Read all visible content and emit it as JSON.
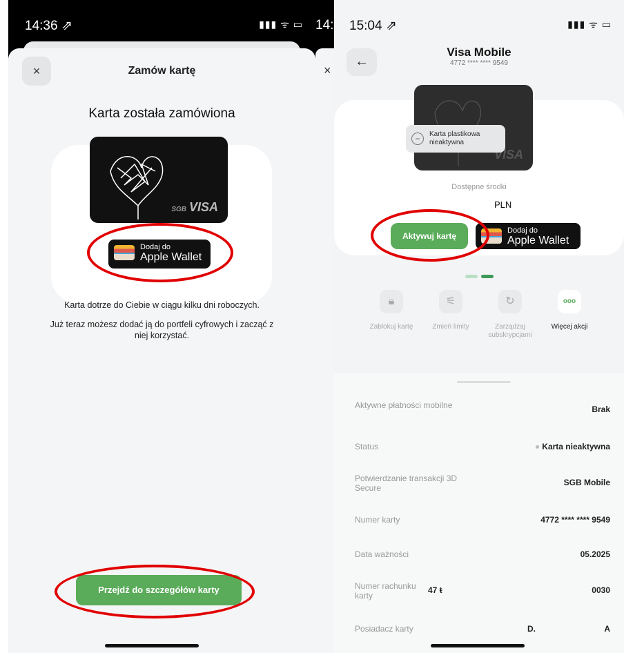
{
  "left": {
    "status": {
      "time": "14:36 ⇗",
      "icons": "▮▮▮ ᯤ ▭"
    },
    "sheet": {
      "close": "×",
      "title": "Zamów kartę",
      "ordered": "Karta została zamówiona",
      "card_brand": "VISA",
      "card_bank": "SGB",
      "wallet_line1": "Dodaj do",
      "wallet_line2": "Apple Wallet",
      "desc1": "Karta dotrze do Ciebie w ciągu kilku dni roboczych.",
      "desc2": "Już teraz możesz dodać ją do portfeli cyfrowych i zacząć z niej korzystać.",
      "button": "Przejdź do szczegółów karty"
    },
    "partial_time": "14:",
    "partial_close": "×"
  },
  "right": {
    "status": {
      "time": "15:04 ⇗",
      "icons": "▮▮▮ ᯤ ▭"
    },
    "back": "←",
    "title": "Visa Mobile",
    "subtitle": "4772 **** **** 9549",
    "card_brand": "VISA",
    "tag": "Karta plastikowa nieaktywna",
    "funds_label": "Dostępne środki",
    "currency": "PLN",
    "activate": "Aktywuj kartę",
    "wallet_line1": "Dodaj do",
    "wallet_line2": "Apple Wallet",
    "actions": [
      {
        "icon": "lock-icon",
        "glyph": "🔒︎",
        "label": "Zablokuj kartę"
      },
      {
        "icon": "sliders-icon",
        "glyph": "⚟",
        "label": "Zmień limity"
      },
      {
        "icon": "refresh-icon",
        "glyph": "↻",
        "label": "Zarządzaj subskrypcjami"
      },
      {
        "icon": "more-icon",
        "glyph": "ooo",
        "label": "Więcej akcji"
      }
    ],
    "details": [
      {
        "k": "Aktywne płatności mobilne",
        "v": "Brak"
      },
      {
        "k": "Status",
        "v": "Karta nieaktywna"
      },
      {
        "k": "Potwierdzanie transakcji 3D Secure",
        "v": "SGB Mobile"
      },
      {
        "k": "Numer karty",
        "v": "4772 **** **** 9549"
      },
      {
        "k": "Data ważności",
        "v": "05.2025"
      },
      {
        "k": "Numer rachunku karty",
        "mid": "47 ŧ",
        "v": "0030"
      },
      {
        "k": "Posiadacz karty",
        "mid": "D.",
        "v": "A"
      }
    ]
  },
  "colors": {
    "accent": "#5aab5a",
    "highlight": "#e10000",
    "dot_active": "#3f9a5a",
    "dot_inactive": "#b9dfc5"
  }
}
